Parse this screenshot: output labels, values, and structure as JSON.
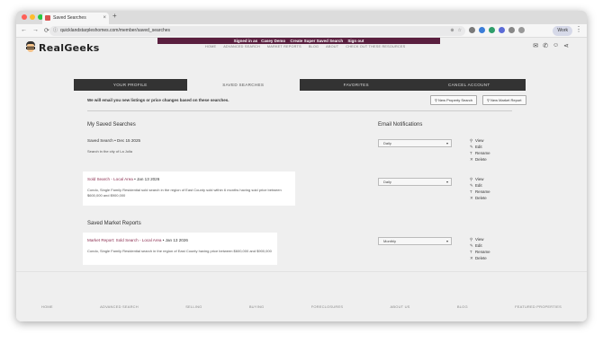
{
  "browser": {
    "tab_title": "Saved Searches",
    "tab_close": "×",
    "new_tab": "+",
    "url": "quicklandstarpleshomes.com/member/saved_searches",
    "work_label": "Work",
    "nav": {
      "back": "←",
      "forward": "→",
      "reload": "⟳"
    }
  },
  "site": {
    "logo_text": "RealGeeks",
    "admin_bar": {
      "signed_in_prefix": "Signed in as",
      "user_name": "Casey Demo",
      "create_search": "Create Super Saved Search",
      "sign_out": "Sign out"
    },
    "nav": [
      "HOME",
      "ADVANCED SEARCH",
      "MARKET REPORTS",
      "BLOG",
      "ABOUT",
      "CHECK OUT THESE RESOURCES"
    ]
  },
  "tabs": [
    "YOUR PROFILE",
    "SAVED SEARCHES",
    "FAVORITES",
    "CANCEL ACCOUNT"
  ],
  "info_text": "We will email you new listings or price changes based on these searches.",
  "buttons": {
    "new_property_search": "New Property Search",
    "new_market_report": "New Market Report"
  },
  "sections": {
    "my_saved_searches": "My Saved Searches",
    "email_notifications": "Email Notifications",
    "saved_market_reports": "Saved Market Reports"
  },
  "saved_searches": [
    {
      "name": "Saved Search",
      "date": "Dec 15 2025",
      "description": "Search in the city of La Jolla",
      "frequency": "Daily"
    },
    {
      "name": "Sold Search - Local Area",
      "date": "Jan 13 2026",
      "description_line1": "Condo, Single Family Residential sold search in the region of East County sold within 6 months having sold price between",
      "description_line2": "$600,000 and $900,000",
      "frequency": "Daily"
    }
  ],
  "market_reports": [
    {
      "name": "Market Report: Sold Search - Local Area",
      "date": "Jan 13 2026",
      "description": "Condo, Single Family Residential search in the region of East County having price between $600,000 and $900,000",
      "frequency": "Monthly"
    }
  ],
  "actions": [
    "View",
    "Edit",
    "Rename",
    "Delete"
  ],
  "footer_links": [
    "HOME",
    "ADVANCED SEARCH",
    "SELLING",
    "BUYING",
    "FORECLOSURES",
    "ABOUT US",
    "BLOG",
    "FEATURED PROPERTIES"
  ],
  "colors": {
    "accent": "#8b2d4f",
    "admin_bar": "#5a1f3f",
    "tab_dark": "#333333"
  }
}
